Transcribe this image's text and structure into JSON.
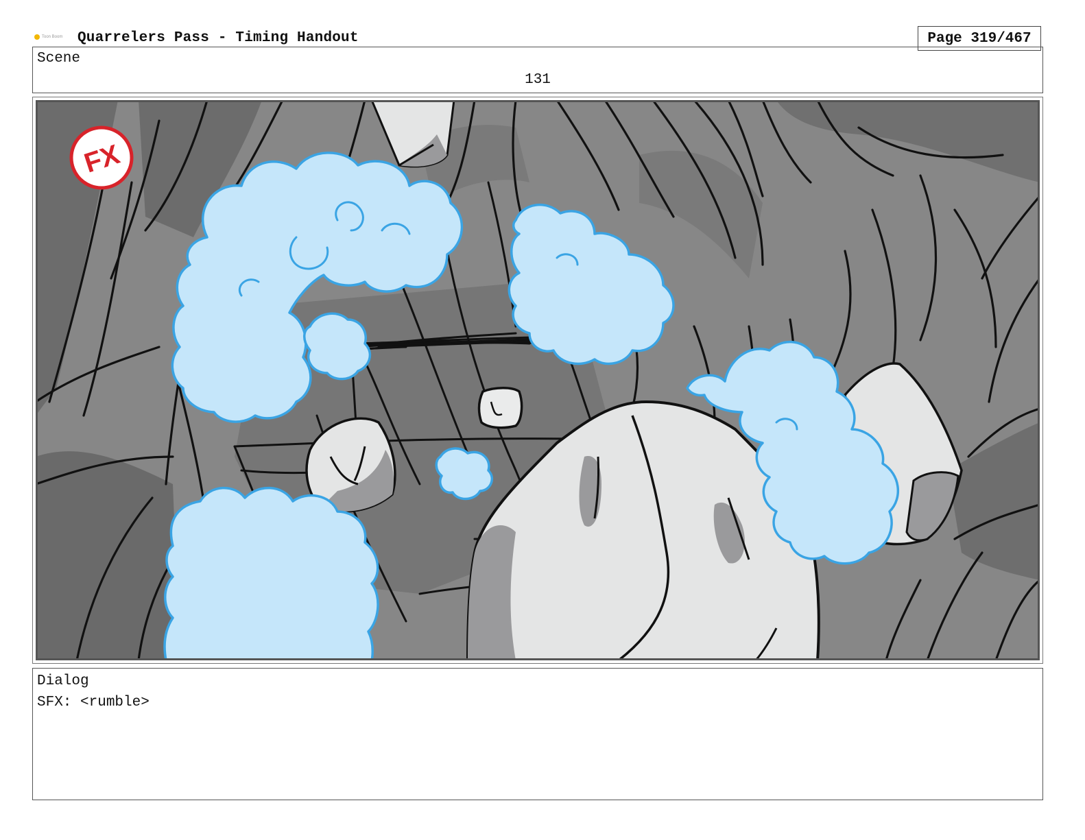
{
  "header": {
    "logo_text": "Toon Boom",
    "title": "Quarrelers Pass - Timing Handout",
    "page": "Page 319/467"
  },
  "scene": {
    "label": "Scene",
    "number": "131"
  },
  "panel": {
    "fx_badge": "FX"
  },
  "dialog": {
    "label": "Dialog",
    "text": "SFX: <rumble>"
  },
  "colors": {
    "cloud_fill": "#c5e6fa",
    "cloud_outline": "#3aa4e4",
    "rock_light": "#e6e8e8",
    "rock_shadow": "#9a9b9d",
    "cave_dark": "#6f6f6f",
    "cave_mid": "#888888",
    "fx_red": "#d8232a"
  }
}
